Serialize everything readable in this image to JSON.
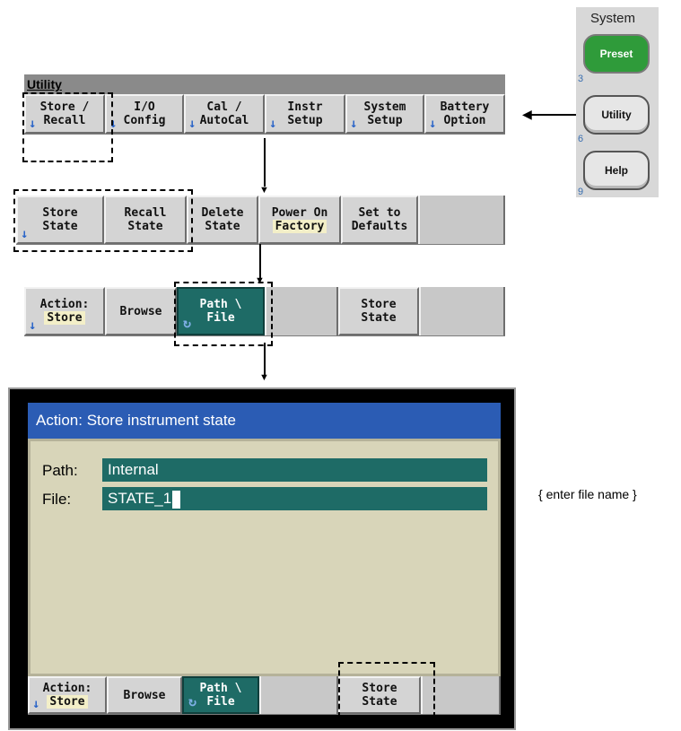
{
  "front_panel": {
    "title": "System",
    "buttons": [
      {
        "label": "Preset",
        "number": "3"
      },
      {
        "label": "Utility",
        "number": "6"
      },
      {
        "label": "Help",
        "number": "9"
      }
    ]
  },
  "utility_menu": {
    "title": "Utility",
    "softkeys": [
      {
        "line1": "Store /",
        "line2": "Recall",
        "submenu": true
      },
      {
        "line1": "I/O",
        "line2": "Config",
        "submenu": true
      },
      {
        "line1": "Cal /",
        "line2": "AutoCal",
        "submenu": true
      },
      {
        "line1": "Instr",
        "line2": "Setup",
        "submenu": true
      },
      {
        "line1": "System",
        "line2": "Setup",
        "submenu": true
      },
      {
        "line1": "Battery",
        "line2": "Option",
        "submenu": true
      }
    ]
  },
  "store_recall_menu": {
    "softkeys": [
      {
        "line1": "Store",
        "line2": "State",
        "submenu": true
      },
      {
        "line1": "Recall",
        "line2": "State"
      },
      {
        "line1": "Delete",
        "line2": "State"
      },
      {
        "line1": "Power On",
        "line2": "Factory"
      },
      {
        "line1": "Set to",
        "line2": "Defaults"
      }
    ]
  },
  "store_state_menu": {
    "softkeys": [
      {
        "line1": "Action:",
        "line2": "Store"
      },
      {
        "line1": "Browse"
      },
      {
        "line1": "Path \\",
        "line2": "File"
      },
      {
        "line1": ""
      },
      {
        "line1": "Store",
        "line2": "State"
      }
    ]
  },
  "display": {
    "title": "Action: Store instrument state",
    "path_label": "Path:",
    "path_value": "Internal",
    "file_label": "File:",
    "file_value": "STATE_1",
    "softkeys": [
      {
        "line1": "Action:",
        "line2": "Store"
      },
      {
        "line1": "Browse"
      },
      {
        "line1": "Path \\",
        "line2": "File"
      },
      {
        "line1": ""
      },
      {
        "line1": "Store",
        "line2": "State"
      }
    ]
  },
  "note": "{ enter file name }",
  "icons": {
    "submenu": "down-arrow-icon",
    "toggle": "refresh-icon"
  },
  "colors": {
    "preset": "#2f9b3a",
    "teal": "#1e6b66",
    "title_bar": "#2b5cb4",
    "screen": "#d8d5b9"
  }
}
